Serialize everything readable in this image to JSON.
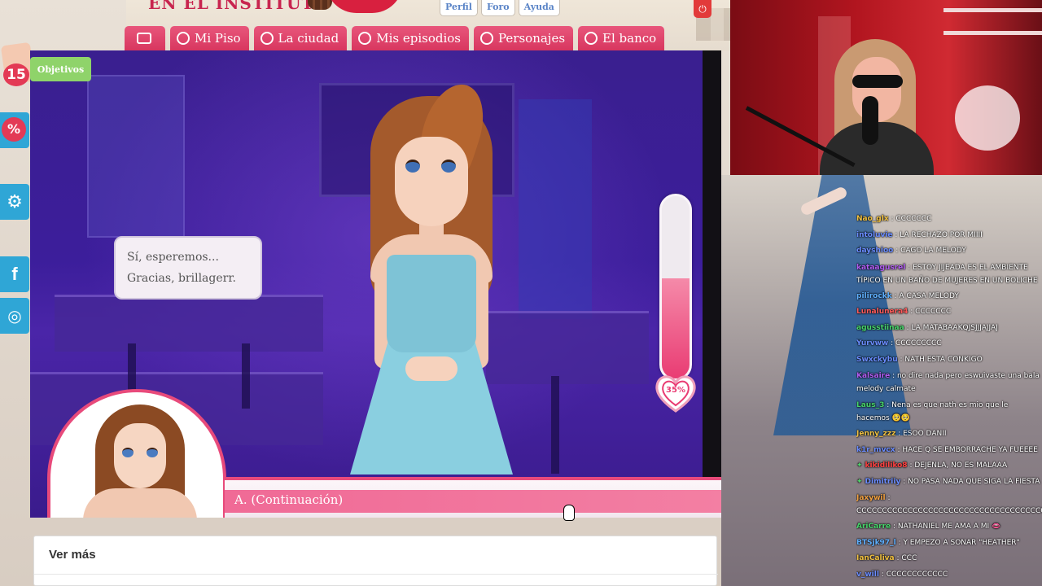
{
  "site": {
    "logo_text": "EN EL INSTITUTO",
    "top_links": [
      "Perfil",
      "Foro",
      "Ayuda"
    ],
    "logout_icon": "power-icon"
  },
  "nav": {
    "home_icon": "home-icon",
    "items": [
      {
        "label": "Mi Piso",
        "icon": "home-icon"
      },
      {
        "label": "La ciudad",
        "icon": "map-pin-icon"
      },
      {
        "label": "Mis episodios",
        "icon": "play-icon"
      },
      {
        "label": "Personajes",
        "icon": "heart-icon"
      },
      {
        "label": "El banco",
        "icon": "coin-icon"
      }
    ]
  },
  "sidebar": {
    "gift_count": "15",
    "percent_label": "%",
    "buttons": [
      {
        "icon": "gear-icon",
        "label": "⚙"
      },
      {
        "icon": "facebook-icon",
        "label": "f"
      },
      {
        "icon": "instagram-icon",
        "label": "◎"
      }
    ]
  },
  "game": {
    "objectives_label": "Objetivos",
    "speech_line1": "Sí, esperemos...",
    "speech_line2": "Gracias, brillagerr.",
    "love_meter": {
      "percent_label": "35%",
      "fill_fraction": 0.35
    },
    "dialog_choice": "A. (Continuación)"
  },
  "ver_mas": {
    "label": "Ver más"
  },
  "colors": {
    "brand_pink": "#e84a7b",
    "nav_pink": "#d8365f",
    "sidebar_blue": "#2fa6d6",
    "objectives_green": "#8fd36a"
  },
  "chat": [
    {
      "user": "Nao_glx",
      "color": "#f0c040",
      "text": "CCCCCCC"
    },
    {
      "user": "intoluvie",
      "color": "#6a8cff",
      "text": "LA RECHAZO POR MIIII"
    },
    {
      "user": "dayshioo",
      "color": "#6a8cff",
      "text": "CAGO LA MELODY"
    },
    {
      "user": "kataagusrel",
      "color": "#b05cf0",
      "text": "ESTOY JIJEADA ES EL AMBIENTE TÍPICO EN UN BAÑO DE MUJERES EN UN BOLICHE",
      "wrap": true
    },
    {
      "user": "pilirockk",
      "color": "#5fb0ff",
      "text": "A CASA MELODY"
    },
    {
      "user": "Lunalunera4",
      "color": "#ff5a5a",
      "text": "CCCCCCC"
    },
    {
      "user": "agusstiinaa",
      "color": "#47d46b",
      "text": "LA MATABAAKQJSJJJAJJAJ"
    },
    {
      "user": "Yurvww",
      "color": "#6a8cff",
      "text": "CCCCCCCCC"
    },
    {
      "user": "Swxckybu",
      "color": "#6a8cff",
      "text": "NATH ESTA CONKIGO"
    },
    {
      "user": "Kalsaire",
      "color": "#b05cf0",
      "text": "no dire nada pero eswuivaste una bala melody calmate",
      "wrap": true
    },
    {
      "user": "Laus_3",
      "color": "#47d46b",
      "text": "Nena es que nath es mio que le hacemos 🥺🥺",
      "wrap": true
    },
    {
      "user": "Jenny_zzz",
      "color": "#f0c040",
      "text": "ESOO DANII"
    },
    {
      "user": "k1r_mvcx",
      "color": "#6a8cff",
      "text": "HACE Q SE EMBORRACHE YA FUEEEE"
    },
    {
      "user": "kikidiliko8",
      "color": "#ff4040",
      "text": "DEJENLA, NO ES MALAAA",
      "badge": true
    },
    {
      "user": "Dimitriiy",
      "color": "#6a8cff",
      "text": "NO PASA NADA QUE SIGA LA FIESTA",
      "badge": true
    },
    {
      "user": "Jaxywil",
      "color": "#f0a040",
      "text": "CCCCCCCCCCCCCCCCCCCCCCCCCCCCCCCCCCCCCCCCCCCCCCCCCCCCCCCCCCCC",
      "wrap": true
    },
    {
      "user": "AriCarre",
      "color": "#47d46b",
      "text": "NATHANIEL ME AMA A MI 👄"
    },
    {
      "user": "BTSjk97_l",
      "color": "#5fb0ff",
      "text": "Y EMPEZO A SONAR \"HEATHER\""
    },
    {
      "user": "IanCaliva",
      "color": "#f0c040",
      "text": "CCC"
    },
    {
      "user": "v_will",
      "color": "#6a8cff",
      "text": "CCCCCCCCCCCC"
    }
  ]
}
